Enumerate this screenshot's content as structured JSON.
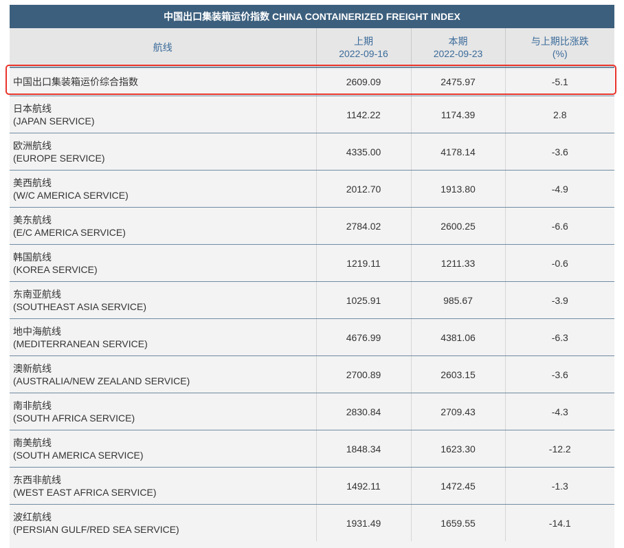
{
  "title": "中国出口集装箱运价指数 CHINA CONTAINERIZED FREIGHT INDEX",
  "headers": {
    "route": "航线",
    "prev_label": "上期",
    "prev_date": "2022-09-16",
    "curr_label": "本期",
    "curr_date": "2022-09-23",
    "change_label": "与上期比涨跌",
    "change_unit": "(%)"
  },
  "composite": {
    "name": "中国出口集装箱运价综合指数",
    "prev": "2609.09",
    "curr": "2475.97",
    "change": "-5.1"
  },
  "rows": [
    {
      "cn": "日本航线",
      "en": "(JAPAN SERVICE)",
      "prev": "1142.22",
      "curr": "1174.39",
      "change": "2.8"
    },
    {
      "cn": "欧洲航线",
      "en": "(EUROPE SERVICE)",
      "prev": "4335.00",
      "curr": "4178.14",
      "change": "-3.6"
    },
    {
      "cn": "美西航线",
      "en": "(W/C AMERICA SERVICE)",
      "prev": "2012.70",
      "curr": "1913.80",
      "change": "-4.9"
    },
    {
      "cn": "美东航线",
      "en": "(E/C AMERICA SERVICE)",
      "prev": "2784.02",
      "curr": "2600.25",
      "change": "-6.6"
    },
    {
      "cn": "韩国航线",
      "en": "(KOREA SERVICE)",
      "prev": "1219.11",
      "curr": "1211.33",
      "change": "-0.6"
    },
    {
      "cn": "东南亚航线",
      "en": "(SOUTHEAST ASIA SERVICE)",
      "prev": "1025.91",
      "curr": "985.67",
      "change": "-3.9"
    },
    {
      "cn": "地中海航线",
      "en": "(MEDITERRANEAN SERVICE)",
      "prev": "4676.99",
      "curr": "4381.06",
      "change": "-6.3"
    },
    {
      "cn": "澳新航线",
      "en": "(AUSTRALIA/NEW ZEALAND SERVICE)",
      "prev": "2700.89",
      "curr": "2603.15",
      "change": "-3.6"
    },
    {
      "cn": "南非航线",
      "en": "(SOUTH AFRICA SERVICE)",
      "prev": "2830.84",
      "curr": "2709.43",
      "change": "-4.3"
    },
    {
      "cn": "南美航线",
      "en": "(SOUTH AMERICA SERVICE)",
      "prev": "1848.34",
      "curr": "1623.30",
      "change": "-12.2"
    },
    {
      "cn": "东西非航线",
      "en": "(WEST EAST AFRICA SERVICE)",
      "prev": "1492.11",
      "curr": "1472.45",
      "change": "-1.3"
    },
    {
      "cn": "波红航线",
      "en": "(PERSIAN GULF/RED SEA SERVICE)",
      "prev": "1931.49",
      "curr": "1659.55",
      "change": "-14.1"
    }
  ],
  "colors": {
    "title_bg": "#3c5f7d",
    "header_text": "#3a6a9a",
    "highlight": "#e8332a"
  }
}
